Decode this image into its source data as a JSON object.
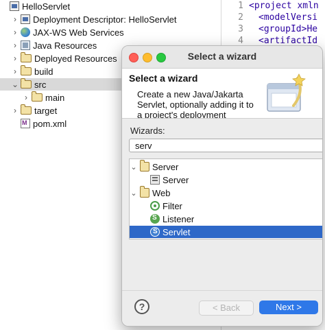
{
  "explorer": {
    "items": [
      {
        "label": "HelloServlet",
        "arrow": "",
        "icon": "project-icon",
        "depth": 0
      },
      {
        "label": "Deployment Descriptor: HelloServlet",
        "arrow": "›",
        "icon": "deployment-descriptor-icon",
        "depth": 1
      },
      {
        "label": "JAX-WS Web Services",
        "arrow": "›",
        "icon": "web-services-icon",
        "depth": 1
      },
      {
        "label": "Java Resources",
        "arrow": "›",
        "icon": "java-resources-icon",
        "depth": 1
      },
      {
        "label": "Deployed Resources",
        "arrow": "›",
        "icon": "deployed-resources-icon",
        "depth": 1
      },
      {
        "label": "build",
        "arrow": "›",
        "icon": "folder-icon",
        "depth": 1
      },
      {
        "label": "src",
        "arrow": "⌄",
        "icon": "folder-open-icon",
        "depth": 1
      },
      {
        "label": "main",
        "arrow": "›",
        "icon": "folder-icon",
        "depth": 2
      },
      {
        "label": "target",
        "arrow": "›",
        "icon": "folder-icon",
        "depth": 1
      },
      {
        "label": "pom.xml",
        "arrow": "",
        "icon": "maven-file-icon",
        "depth": 1
      }
    ]
  },
  "editor": {
    "lines": [
      {
        "num": "1",
        "code": "<project xmln"
      },
      {
        "num": "2",
        "code": "<modelVersi"
      },
      {
        "num": "3",
        "code": "<groupId>He"
      },
      {
        "num": "4",
        "code": "<artifactId"
      }
    ]
  },
  "dialog": {
    "title": "Select a wizard",
    "banner_title": "Select a wizard",
    "banner_desc": "Create a new Java/Jakarta Servlet, optionally adding it to a project's deployment",
    "wizards_label": "Wizards:",
    "filter_value": "serv",
    "tree": [
      {
        "label": "Server",
        "arrow": "⌄",
        "icon": "folder-open-icon",
        "depth": 0
      },
      {
        "label": "Server",
        "arrow": "",
        "icon": "server-wizard-icon",
        "depth": 1
      },
      {
        "label": "Web",
        "arrow": "⌄",
        "icon": "folder-open-icon",
        "depth": 0
      },
      {
        "label": "Filter",
        "arrow": "",
        "icon": "filter-wizard-icon",
        "depth": 1
      },
      {
        "label": "Listener",
        "arrow": "",
        "icon": "listener-wizard-icon",
        "depth": 1
      },
      {
        "label": "Servlet",
        "arrow": "",
        "icon": "servlet-wizard-icon",
        "depth": 1,
        "selected": true
      }
    ],
    "help_label": "?",
    "back_label": "< Back",
    "next_label": "Next >"
  },
  "colors": {
    "selection": "#2e68c8",
    "next_button": "#2f78e8",
    "close": "#ff5f57",
    "minimize": "#febc2e",
    "zoom": "#28c840",
    "xml_tag": "#2a00a0"
  }
}
